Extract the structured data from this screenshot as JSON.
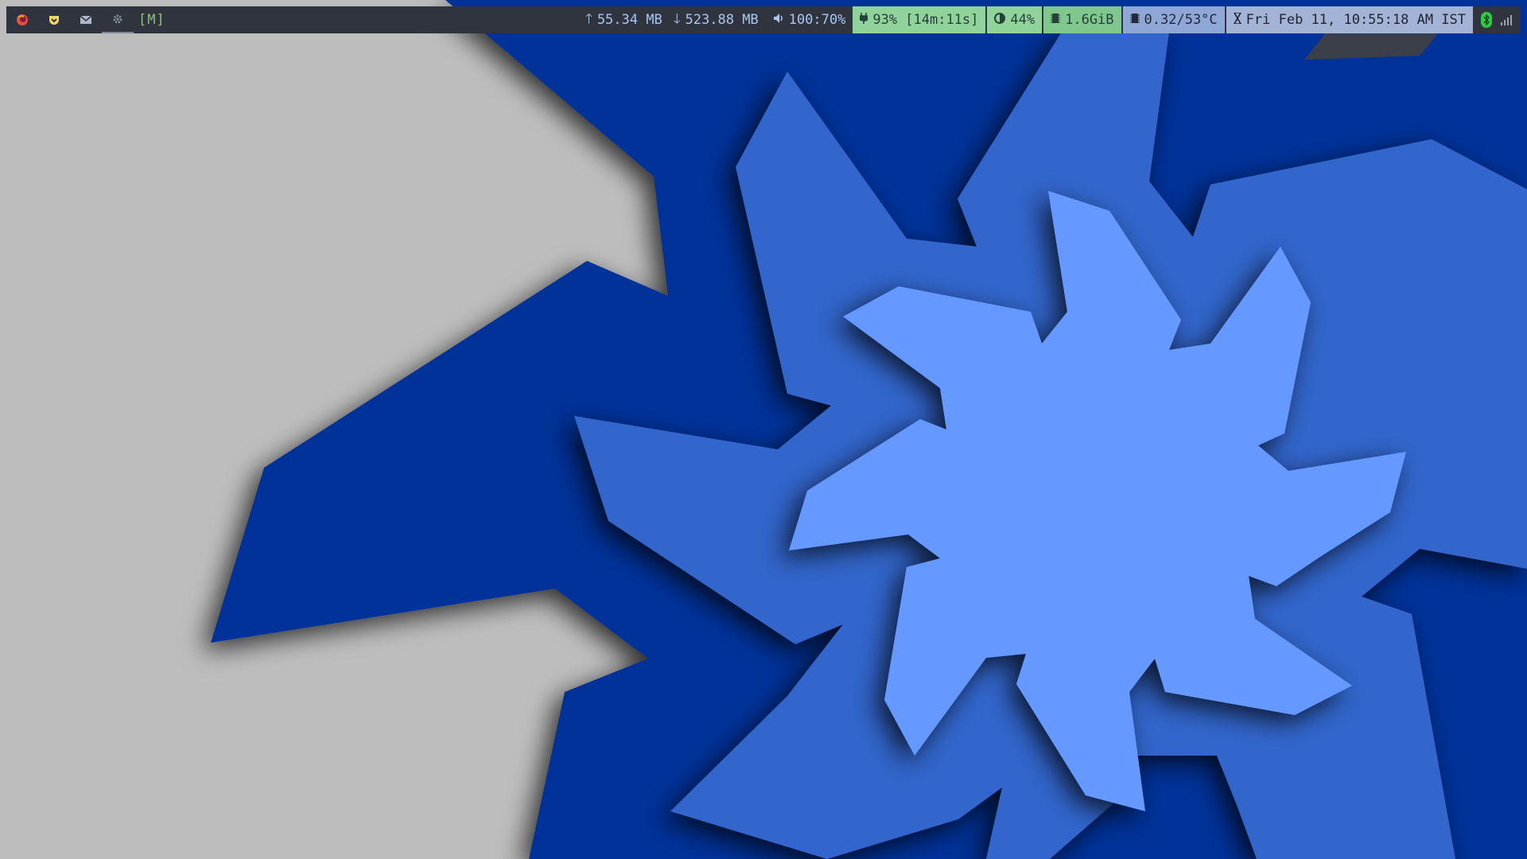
{
  "colors": {
    "bar_bg": "#2f343f",
    "wall_gray": "#bdbdbd",
    "wall_navy": "#003399",
    "wall_mid": "#3366cc",
    "wall_light": "#6699ff"
  },
  "left": {
    "icons": [
      "firefox-icon",
      "pocket-icon",
      "mail-icon",
      "settings-icon"
    ],
    "mode": "[M]"
  },
  "network": {
    "up": "55.34 MB",
    "down": "523.88 MB"
  },
  "volume": {
    "text": "100:70%"
  },
  "battery": {
    "text": "93% [14m:11s]"
  },
  "brightness": {
    "text": "44%"
  },
  "memory": {
    "text": "1.6GiB"
  },
  "cpu": {
    "text": "0.32/53°C"
  },
  "datetime": {
    "text": "Fri Feb 11, 10:55:18 AM IST"
  },
  "tray": {
    "icons": [
      "bluetooth-icon",
      "signal-icon"
    ]
  }
}
